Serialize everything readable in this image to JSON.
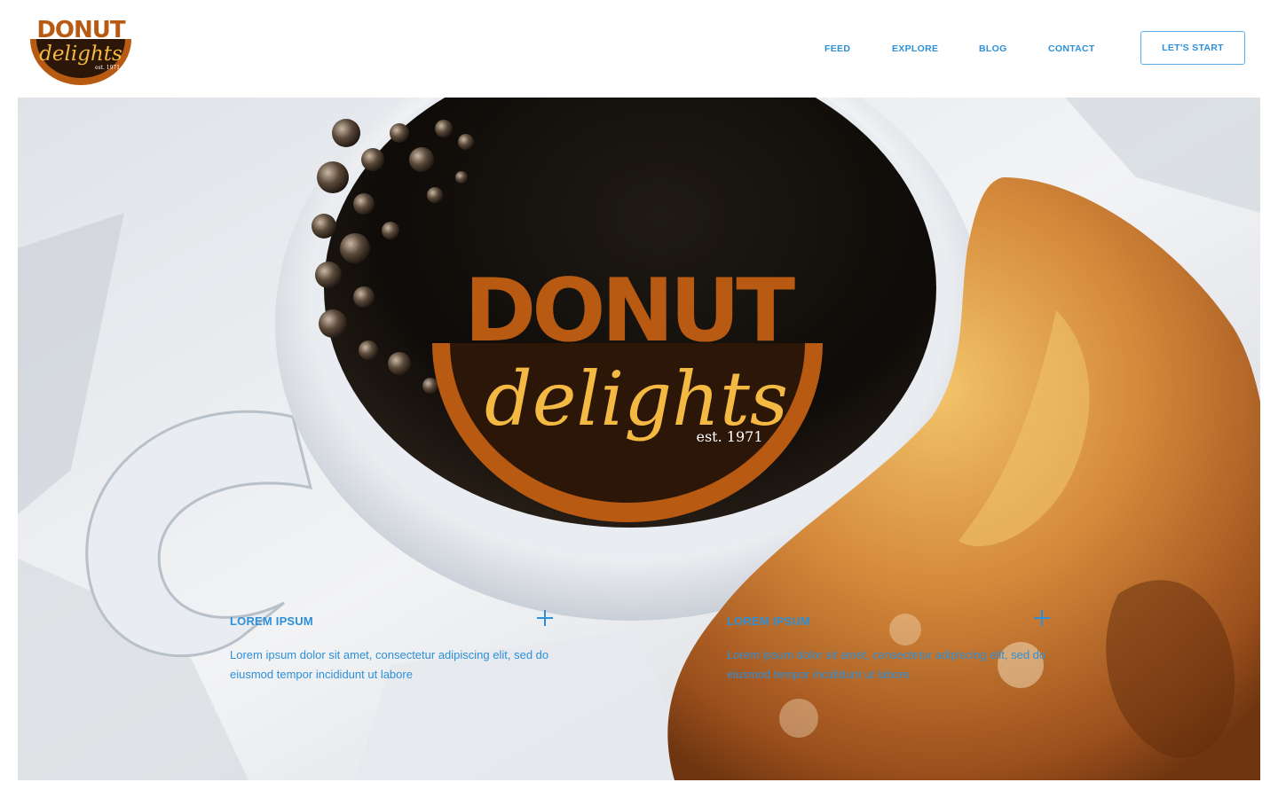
{
  "brand": {
    "word_top": "DONUT",
    "word_script": "delights",
    "established": "est. 1971",
    "colors": {
      "orange": "#b85a12",
      "brown": "#2b1608",
      "gold": "#f4b942",
      "accent": "#2d8fd8"
    }
  },
  "nav": {
    "items": [
      {
        "label": "FEED"
      },
      {
        "label": "EXPLORE"
      },
      {
        "label": "BLOG"
      },
      {
        "label": "CONTACT"
      }
    ],
    "cta_label": "LET'S START"
  },
  "hero": {
    "image": "coffee-cup-and-glazed-donut-photo",
    "features": [
      {
        "title": "LOREM IPSUM",
        "text": "Lorem ipsum dolor sit amet, consectetur adipiscing elit, sed do eiusmod tempor incididunt ut labore",
        "icon": "plus-icon"
      },
      {
        "title": "LOREM IPSUM",
        "text": "Lorem ipsum dolor sit amet, consectetur adipiscing elit, sed do eiusmod tempor incididunt ut labore",
        "icon": "plus-icon"
      }
    ]
  }
}
